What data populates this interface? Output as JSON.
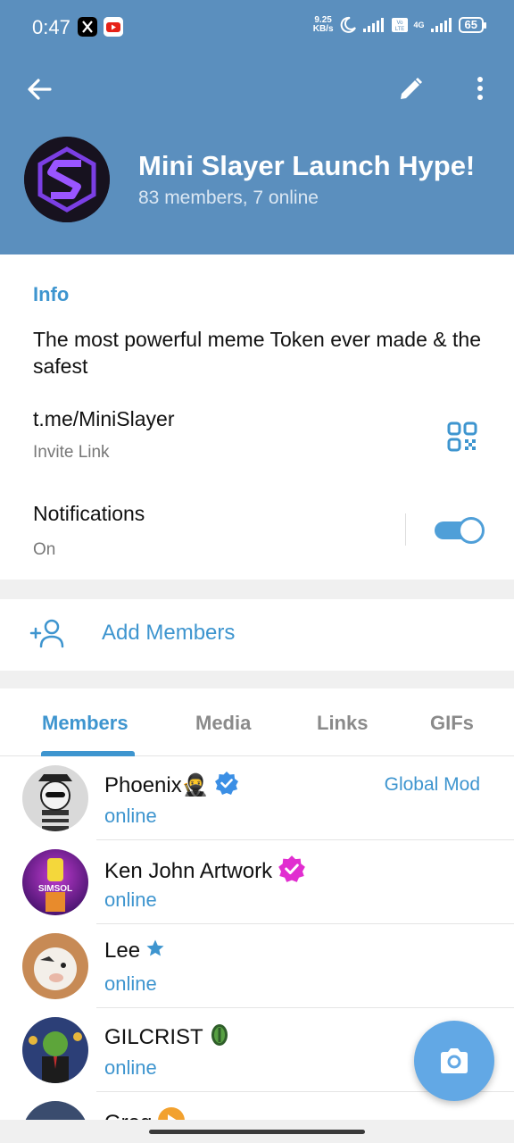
{
  "status_bar": {
    "time": "0:47",
    "speed_value": "9.25",
    "speed_unit": "KB/s",
    "network_label": "4G",
    "battery": "65"
  },
  "header": {
    "title": "Mini Slayer Launch Hype!",
    "subtitle": "83 members, 7 online"
  },
  "info": {
    "heading": "Info",
    "description": "The most powerful meme Token ever made & the safest",
    "link": "t.me/MiniSlayer",
    "link_label": "Invite Link",
    "notifications_label": "Notifications",
    "notifications_state": "On",
    "notifications_enabled": true
  },
  "add_members": {
    "label": "Add Members"
  },
  "tabs": [
    {
      "label": "Members",
      "active": true
    },
    {
      "label": "Media",
      "active": false
    },
    {
      "label": "Links",
      "active": false
    },
    {
      "label": "GIFs",
      "active": false
    }
  ],
  "members": [
    {
      "name": "Phoenix🥷",
      "status": "online",
      "role": "Global Mod",
      "badge": "verified-blue-icon"
    },
    {
      "name": "Ken John Artwork",
      "status": "online",
      "role": "",
      "badge": "verified-pink-icon",
      "avatar_text": "SIMSOL"
    },
    {
      "name": "Lee",
      "status": "online",
      "role": "",
      "badge": "star-icon"
    },
    {
      "name": "GILCRIST",
      "status": "online",
      "role": "",
      "badge": "coin-icon"
    },
    {
      "name": "Greg",
      "status": "",
      "role": "",
      "badge": "play-badge-icon"
    }
  ],
  "colors": {
    "header_bg": "#5b8fbe",
    "accent": "#3e95cf",
    "fab": "#62a8e5"
  }
}
